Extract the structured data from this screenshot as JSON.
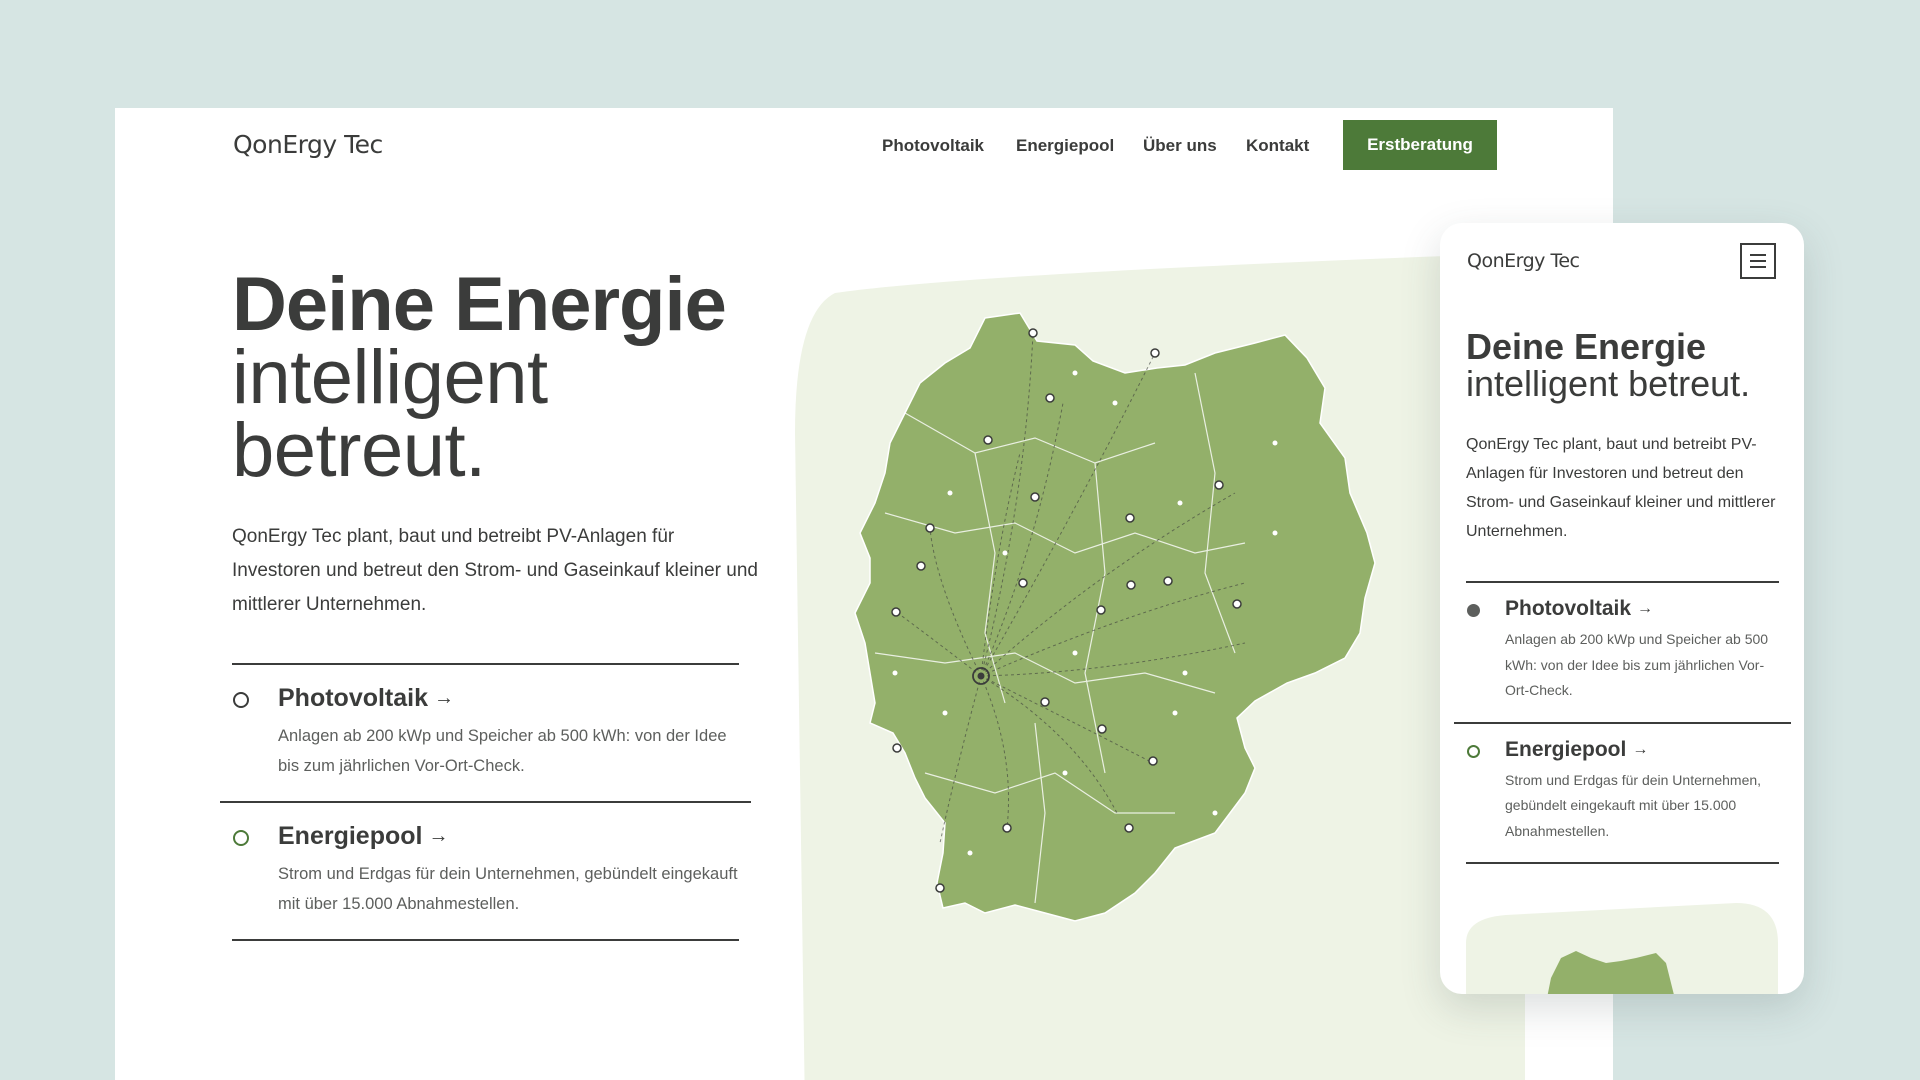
{
  "brand": "QonErgy Tec",
  "nav": {
    "items": [
      "Photovoltaik",
      "Energiepool",
      "Über uns",
      "Kontakt"
    ],
    "cta": "Erstberatung"
  },
  "hero": {
    "headline_bold": "Deine Energie",
    "headline_light_1": "intelligent",
    "headline_light_2": "betreut.",
    "intro": "QonErgy Tec plant, baut und betreibt PV-Anlagen für Investoren und betreut den Strom- und Gaseinkauf kleiner und mittlerer Unternehmen."
  },
  "features": [
    {
      "title": "Photovoltaik",
      "desc": "Anlagen ab 200 kWp und Speicher ab 500 kWh: von der Idee bis zum jährlichen Vor-Ort-Check."
    },
    {
      "title": "Energiepool",
      "desc": "Strom und Erdgas für dein Unternehmen, gebündelt eingekauft mit über 15.000 Abnahmestellen."
    }
  ],
  "mobile": {
    "headline_bold": "Deine Energie",
    "headline_light": "intelligent betreut.",
    "menu_icon": "hamburger-icon"
  },
  "icons": {
    "arrow": "→",
    "map": "germany-map-icon"
  },
  "colors": {
    "background": "#d6e5e3",
    "accent": "#4d7a39",
    "map_fill": "#93b06a",
    "map_panel": "#eef3e5",
    "text": "#3b3c3b"
  }
}
